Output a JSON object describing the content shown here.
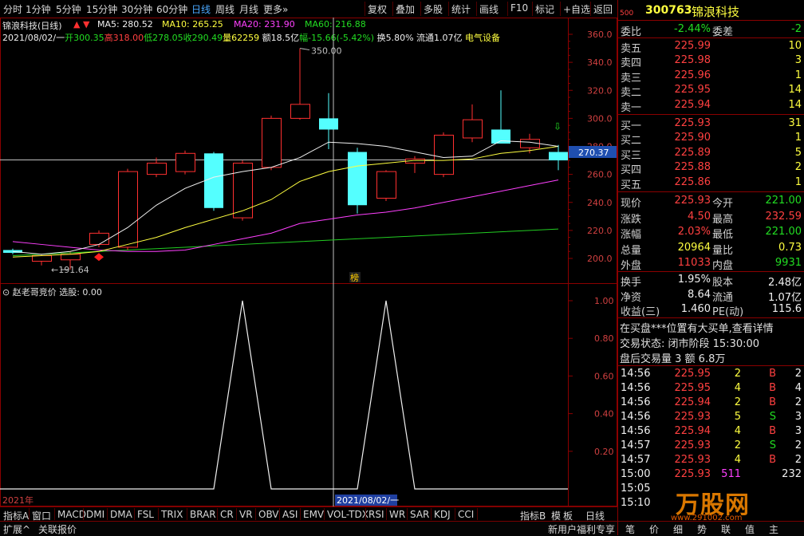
{
  "toolbar": {
    "periods": [
      "分时",
      "1分钟",
      "5分钟",
      "15分钟",
      "30分钟",
      "60分钟",
      "日线",
      "周线",
      "月线",
      "更多»"
    ],
    "active_index": 6,
    "tools": [
      "复权",
      "叠加",
      "多股",
      "统计",
      "画线",
      "F10",
      "标记",
      "+自选",
      "返回"
    ]
  },
  "chart_header": {
    "stock_title": "锦浪科技(日线)",
    "ma5": "MA5: 280.52",
    "ma10": "MA10: 265.25",
    "ma20": "MA20: 231.90",
    "ma60": "MA60: 216.88",
    "ohlc_line": {
      "date": "2021/08/02/一",
      "open": "开300.35",
      "high": "高318.00",
      "low": "低278.05",
      "close": "收290.49",
      "volume": "量62259",
      "amount": "额18.5亿",
      "change": "幅-15.66(-5.42%)",
      "turnover": "换5.80%",
      "float": "流通1.07亿",
      "sector": "电气设备"
    },
    "high_marker": "350.00",
    "low_marker": "191.64",
    "current_price_tag": "270.37",
    "bang_label": "榜"
  },
  "chart_data": {
    "type": "candlestick",
    "y_axis_ticks": [
      "360.0",
      "340.0",
      "320.0",
      "300.0",
      "280.0",
      "260.0",
      "240.0",
      "220.0",
      "200.0"
    ],
    "candles": [
      {
        "o": 206,
        "c": 204,
        "h": 207,
        "l": 203
      },
      {
        "o": 198,
        "c": 202,
        "h": 203,
        "l": 195
      },
      {
        "o": 199,
        "c": 203,
        "h": 205,
        "l": 192
      },
      {
        "o": 210,
        "c": 218,
        "h": 220,
        "l": 208
      },
      {
        "o": 208,
        "c": 262,
        "h": 264,
        "l": 206
      },
      {
        "o": 260,
        "c": 268,
        "h": 272,
        "l": 258
      },
      {
        "o": 262,
        "c": 275,
        "h": 277,
        "l": 260
      },
      {
        "o": 275,
        "c": 236,
        "h": 276,
        "l": 234
      },
      {
        "o": 229,
        "c": 268,
        "h": 270,
        "l": 227
      },
      {
        "o": 265,
        "c": 300,
        "h": 302,
        "l": 263
      },
      {
        "o": 300,
        "c": 310,
        "h": 350,
        "l": 299
      },
      {
        "o": 300,
        "c": 292,
        "h": 318,
        "l": 278
      },
      {
        "o": 276,
        "c": 238,
        "h": 279,
        "l": 232
      },
      {
        "o": 243,
        "c": 262,
        "h": 263,
        "l": 241
      },
      {
        "o": 268,
        "c": 271,
        "h": 273,
        "l": 261
      },
      {
        "o": 260,
        "c": 288,
        "h": 290,
        "l": 258
      },
      {
        "o": 286,
        "c": 299,
        "h": 310,
        "l": 283
      },
      {
        "o": 292,
        "c": 282,
        "h": 320,
        "l": 282
      },
      {
        "o": 279,
        "c": 285,
        "h": 289,
        "l": 275
      },
      {
        "o": 276,
        "c": 270,
        "h": 281,
        "l": 263
      }
    ],
    "ma5": [
      205,
      203,
      205,
      210,
      222,
      238,
      250,
      258,
      262,
      265,
      272,
      283,
      282,
      280,
      276,
      272,
      273,
      284,
      283,
      280
    ],
    "ma10": [
      201,
      202,
      203,
      205,
      210,
      215,
      222,
      228,
      234,
      242,
      255,
      262,
      266,
      268,
      270,
      270,
      271,
      275,
      277,
      280
    ],
    "ma20": [
      212,
      210,
      208,
      206,
      205,
      205,
      206,
      210,
      214,
      218,
      225,
      228,
      231,
      233,
      236,
      240,
      244,
      248,
      252,
      256
    ],
    "ma60": [
      202,
      203,
      204,
      205,
      206,
      207,
      208,
      209,
      210,
      211,
      212,
      213,
      214,
      215,
      216,
      217,
      218,
      219,
      220,
      221
    ],
    "indicator": {
      "name": "赵老哥竞价",
      "param": "选股: 0.00",
      "y_ticks": [
        "1.00",
        "0.80",
        "0.60",
        "0.40",
        "0.20"
      ],
      "values": [
        0,
        0,
        0,
        0,
        0,
        0,
        0,
        0,
        1,
        0,
        0,
        0,
        0,
        1,
        0,
        0,
        0,
        0,
        0,
        0
      ]
    },
    "x_labels": [
      "2021年",
      "2021/08/02/一"
    ]
  },
  "bottom_tabs": [
    "指标A",
    "窗口",
    "MACD",
    "DMI",
    "DMA",
    "FSL",
    "TRIX",
    "BRAR",
    "CR",
    "VR",
    "OBV",
    "ASI",
    "EMV",
    "VOL-TDX",
    "RSI",
    "WR",
    "SAR",
    "KDJ",
    "CCI"
  ],
  "bottom_right": [
    "指标B",
    "模",
    "板"
  ],
  "bottom_period": "日线",
  "status_left": [
    "扩展^",
    "关联报价"
  ],
  "status_right": "新用户福利专享",
  "status_tabs": [
    "笔",
    "价",
    "细",
    "势",
    "联",
    "值",
    "主"
  ],
  "quote": {
    "code_prefix": "500",
    "code": "300763",
    "name": "锦浪科技",
    "weibi_label": "委比",
    "weibi": "-2.44%",
    "weicha_label": "委差",
    "weicha": "-2",
    "asks": [
      {
        "label": "卖五",
        "price": "225.99",
        "vol": "10"
      },
      {
        "label": "卖四",
        "price": "225.98",
        "vol": "3"
      },
      {
        "label": "卖三",
        "price": "225.96",
        "vol": "1"
      },
      {
        "label": "卖二",
        "price": "225.95",
        "vol": "14"
      },
      {
        "label": "卖一",
        "price": "225.94",
        "vol": "14"
      }
    ],
    "bids": [
      {
        "label": "买一",
        "price": "225.93",
        "vol": "31"
      },
      {
        "label": "买二",
        "price": "225.90",
        "vol": "1"
      },
      {
        "label": "买三",
        "price": "225.89",
        "vol": "5"
      },
      {
        "label": "买四",
        "price": "225.88",
        "vol": "2"
      },
      {
        "label": "买五",
        "price": "225.86",
        "vol": "1"
      }
    ],
    "stats": [
      {
        "l1": "现价",
        "v1": "225.93",
        "c1": "red",
        "l2": "今开",
        "v2": "221.00",
        "c2": "green"
      },
      {
        "l1": "涨跌",
        "v1": "4.50",
        "c1": "red",
        "l2": "最高",
        "v2": "232.59",
        "c2": "red"
      },
      {
        "l1": "涨幅",
        "v1": "2.03%",
        "c1": "red",
        "l2": "最低",
        "v2": "221.00",
        "c2": "green"
      },
      {
        "l1": "总量",
        "v1": "20964",
        "c1": "yellow",
        "l2": "量比",
        "v2": "0.73",
        "c2": "yellow"
      },
      {
        "l1": "外盘",
        "v1": "11033",
        "c1": "red",
        "l2": "内盘",
        "v2": "9931",
        "c2": "green"
      }
    ],
    "stats2": [
      {
        "l1": "换手",
        "v1": "1.95%",
        "l2": "股本",
        "v2": "2.48亿"
      },
      {
        "l1": "净资",
        "v1": "8.64",
        "l2": "流通",
        "v2": "1.07亿"
      },
      {
        "l1": "收益(三)",
        "v1": "1.460",
        "l2": "PE(动)",
        "v2": "115.6"
      }
    ],
    "notice": "在买盘***位置有大买单,查看详情",
    "trade_status": "交易状态: 闭市阶段 15:30:00",
    "after_hours": "盘后交易量 3 额 6.8万",
    "ticks": [
      {
        "t": "14:56",
        "p": "225.95",
        "v": "2",
        "bs": "B",
        "n": "2"
      },
      {
        "t": "14:56",
        "p": "225.95",
        "v": "4",
        "bs": "B",
        "n": "4"
      },
      {
        "t": "14:56",
        "p": "225.94",
        "v": "2",
        "bs": "B",
        "n": "2"
      },
      {
        "t": "14:56",
        "p": "225.93",
        "v": "5",
        "bs": "S",
        "n": "3"
      },
      {
        "t": "14:56",
        "p": "225.94",
        "v": "4",
        "bs": "B",
        "n": "3"
      },
      {
        "t": "14:57",
        "p": "225.93",
        "v": "2",
        "bs": "S",
        "n": "2"
      },
      {
        "t": "14:57",
        "p": "225.93",
        "v": "4",
        "bs": "B",
        "n": "2"
      },
      {
        "t": "15:00",
        "p": "225.93",
        "v": "511",
        "bs": "",
        "n": "232"
      },
      {
        "t": "15:05",
        "p": "",
        "v": "",
        "bs": "",
        "n": ""
      },
      {
        "t": "15:10",
        "p": "",
        "v": "",
        "bs": "",
        "n": ""
      }
    ],
    "watermark": "万股网",
    "watermark_url": "www.291002.com"
  }
}
